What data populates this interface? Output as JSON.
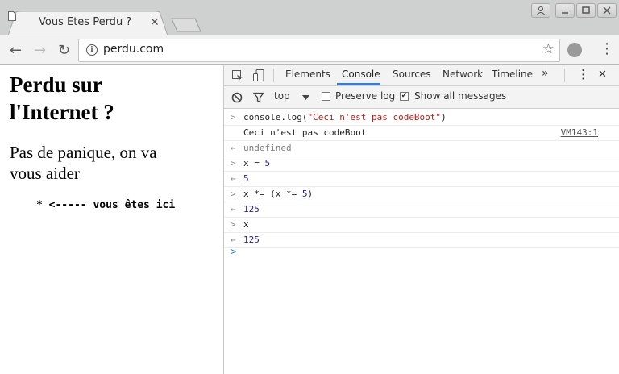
{
  "tab": {
    "title": "Vous Etes Perdu ?",
    "close": "✕"
  },
  "toolbar": {
    "url": "perdu.com",
    "back": "←",
    "forward": "→",
    "reload": "↻",
    "star": "☆",
    "menu": "⋮"
  },
  "page": {
    "h1_line1": "Perdu sur",
    "h1_line2": "l'Internet ?",
    "h2_line1": "Pas de panique, on va",
    "h2_line2": "vous aider",
    "pointer": "* <----- vous êtes ici"
  },
  "devtools": {
    "tabs": [
      "Elements",
      "Console",
      "Sources",
      "Network",
      "Timeline"
    ],
    "more": "»",
    "menu": "⋮",
    "close": "✕",
    "context": "top",
    "preserve_log": "Preserve log",
    "show_all": "Show all messages",
    "colors": {
      "accent": "#3879d9",
      "number": "#1c1c9c",
      "string": "#c41a16"
    }
  },
  "console": {
    "r1_prefix": ">",
    "r1_a": "console.log(",
    "r1_str": "\"Ceci n'est pas codeBoot\"",
    "r1_b": ")",
    "r2_text": "Ceci n'est pas codeBoot",
    "r2_src": "VM143:1",
    "r3_prefix": "←",
    "r3_text": "undefined",
    "r4_prefix": ">",
    "r4_a": "x = ",
    "r4_num": "5",
    "r5_prefix": "←",
    "r5_text": "5",
    "r6_prefix": ">",
    "r6_a": "x *= (x *= ",
    "r6_num": "5",
    "r6_b": ")",
    "r7_prefix": "←",
    "r7_text": "125",
    "r8_prefix": ">",
    "r8_text": "x",
    "r9_prefix": "←",
    "r9_text": "125",
    "prompt": ">"
  }
}
